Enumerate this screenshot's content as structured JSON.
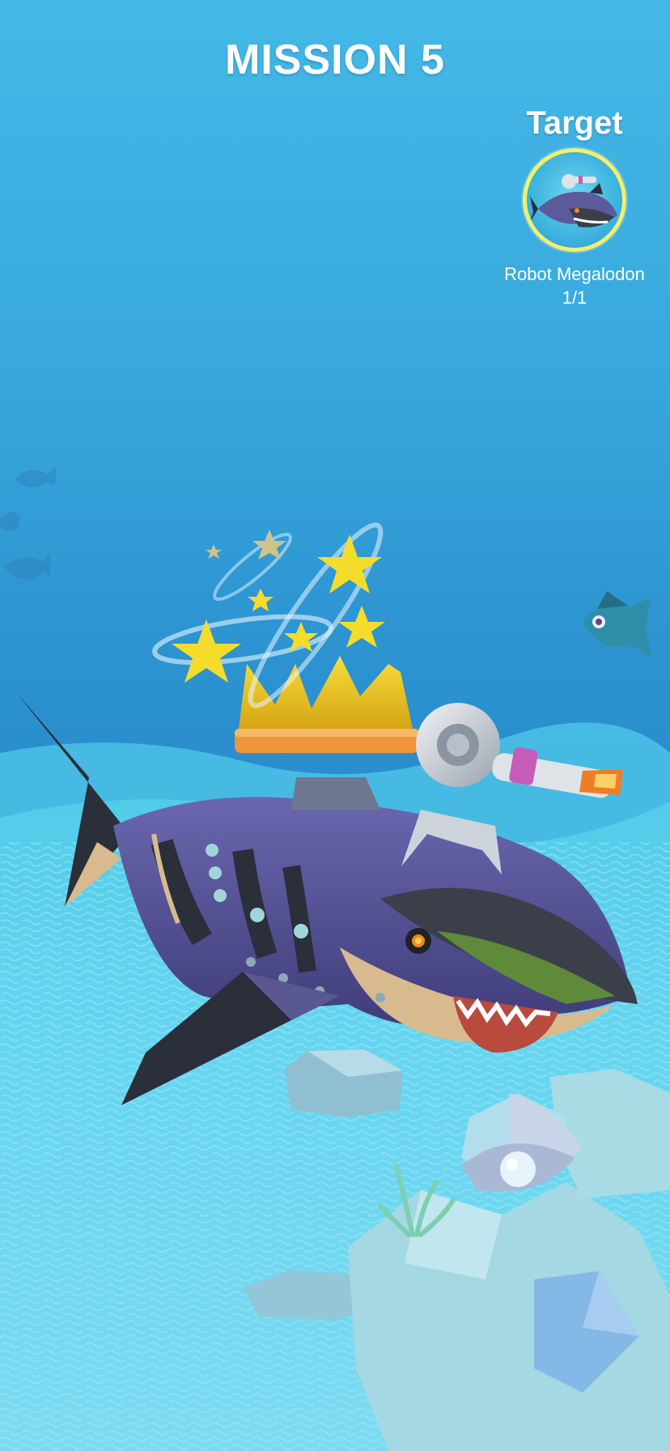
{
  "hud": {
    "title": "MISSION 5",
    "target": {
      "label": "Target",
      "creature_name": "Robot Megalodon",
      "progress": "1/1"
    }
  },
  "scene": {
    "player_creature": "robot-megalodon",
    "effects": [
      "crown",
      "dizzy-stars",
      "back-laser-cannon"
    ],
    "background": "underwater-seabed"
  },
  "colors": {
    "water_top": "#44b9e6",
    "water_mid": "#2a8ccc",
    "seabed": "#6fd4ea",
    "portrait_ring": "#f4ef6a",
    "shark_body": "#5d5a9c",
    "crown": "#e8c21c",
    "star": "#f5dc2a"
  }
}
